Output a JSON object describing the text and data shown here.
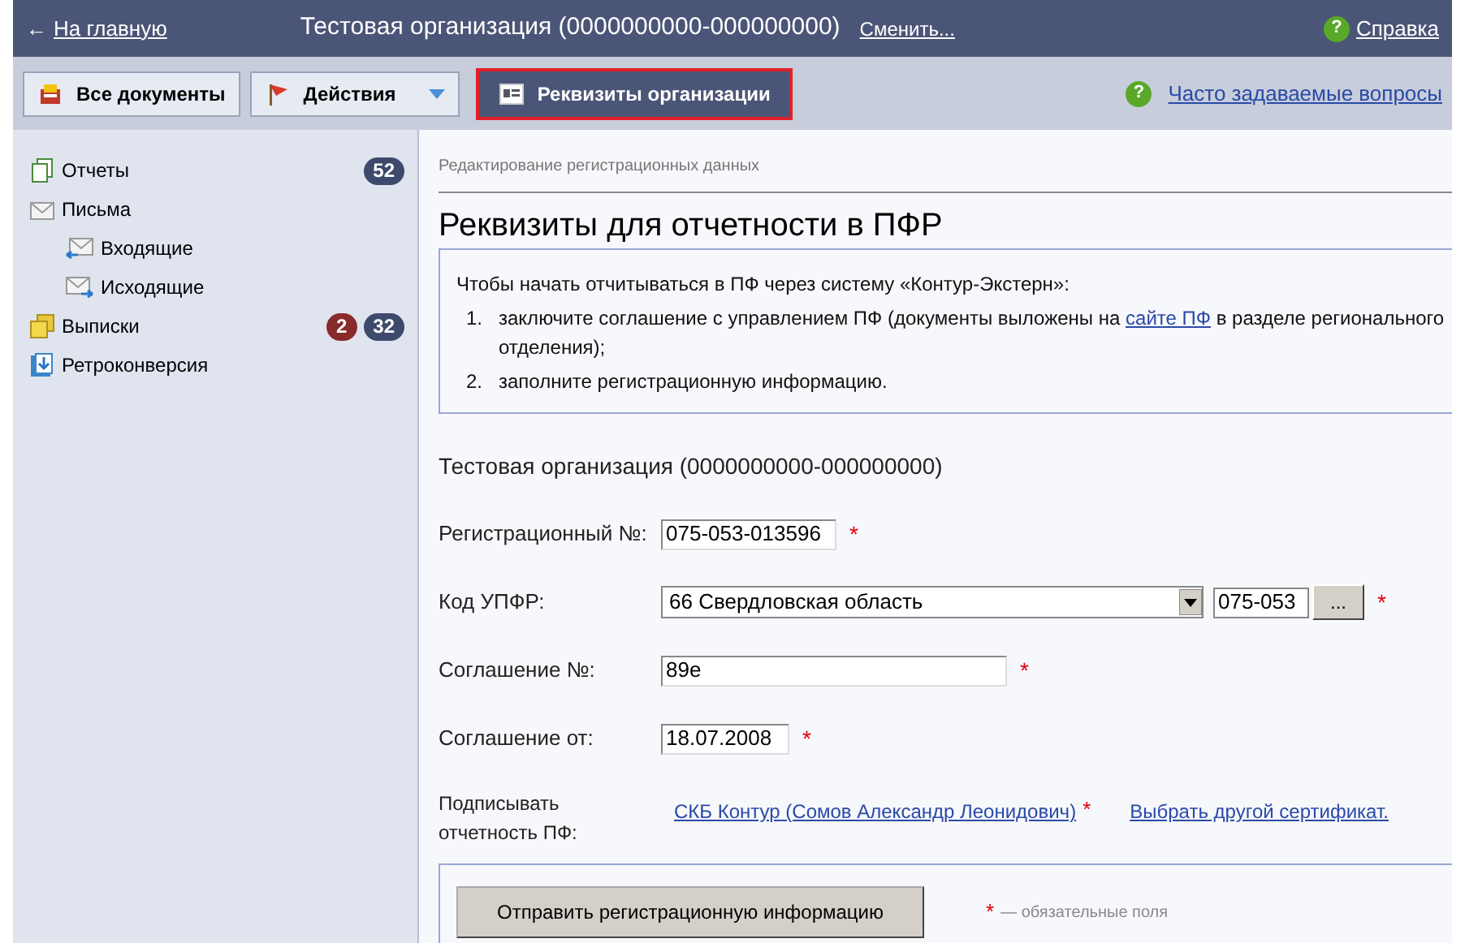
{
  "top_bar": {
    "back_arrow": "←",
    "home_link": "На главную",
    "organization": "Тестовая организация (0000000000-000000000)",
    "change_link": "Сменить...",
    "help_icon": "?",
    "help_link": "Справка"
  },
  "toolbar": {
    "buttons": [
      {
        "label": "Все документы",
        "kind": "docs",
        "selected": false
      },
      {
        "label": "Действия",
        "kind": "actions",
        "selected": false
      },
      {
        "label": "Реквизиты организации",
        "kind": "card",
        "selected": true
      }
    ],
    "faq_icon": "?",
    "faq_link": "Часто задаваемые вопросы"
  },
  "sidebar": {
    "items": [
      {
        "label": "Отчеты",
        "kind": "reports",
        "badges": [
          {
            "text": "52",
            "color": "#3d4a6b"
          }
        ]
      },
      {
        "label": "Письма",
        "kind": "letters",
        "children": [
          {
            "label": "Входящие",
            "kind": "inbox"
          },
          {
            "label": "Исходящие",
            "kind": "outbox"
          }
        ]
      },
      {
        "label": "Выписки",
        "kind": "statements",
        "badges": [
          {
            "text": "2",
            "color": "#8a2b2b"
          },
          {
            "text": "32",
            "color": "#3d4a6b"
          }
        ]
      },
      {
        "label": "Ретроконверсия",
        "kind": "retro"
      }
    ]
  },
  "breadcrumb": "Редактирование регистрационных данных",
  "title": "Реквизиты для отчетности в ПФР",
  "info": {
    "intro": "Чтобы начать отчитываться в ПФ через систему «Контур-Экстерн»:",
    "steps": [
      {
        "number": "1.",
        "before": "заключите соглашение с управлением ПФ (документы выложены на ",
        "link": "сайте ПФ",
        "after": " в разделе регионального отделения);"
      },
      {
        "number": "2.",
        "before": "заполните регистрационную информацию."
      }
    ]
  },
  "organization": "Тестовая организация (0000000000-000000000)",
  "fields": [
    {
      "label": "Регистрационный №:",
      "kind": "text",
      "value": "075-053-013596",
      "mark": "*"
    },
    {
      "label": "Код УПФР:",
      "kind": "select",
      "value": "66 Свердловская область",
      "code": "075-053",
      "picker": "...",
      "mark": "*"
    },
    {
      "label": "Соглашение №:",
      "kind": "text",
      "value": "89е",
      "mark": "*"
    },
    {
      "label": "Соглашение от:",
      "kind": "text",
      "value": "18.07.2008",
      "mark": "*"
    }
  ],
  "signer": {
    "label": "Подписывать отчетность ПФ:",
    "certificate_link": "СКБ Контур (Сомов Александр Леонидович)",
    "mark": "*",
    "other_link": "Выбрать другой сертификат."
  },
  "submit": {
    "button": "Отправить регистрационную информацию",
    "mark": "*",
    "legend": "— обязательные поля"
  }
}
